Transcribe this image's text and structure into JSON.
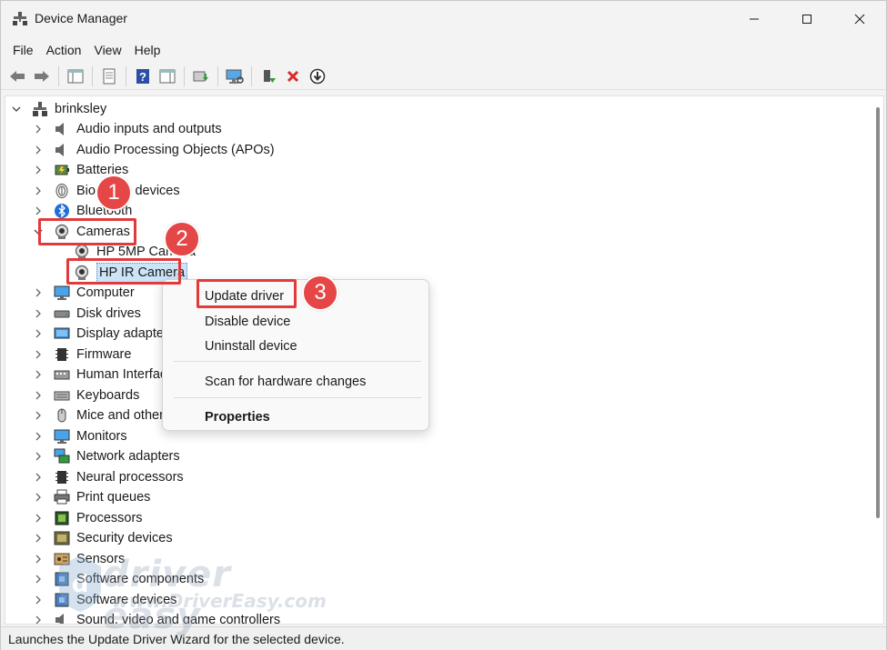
{
  "window": {
    "title": "Device Manager"
  },
  "menu": [
    "File",
    "Action",
    "View",
    "Help"
  ],
  "toolbar": [
    "back-icon",
    "forward-icon",
    "show-hide-console-tree-icon",
    "properties-icon",
    "help-icon",
    "action-pane-icon",
    "update-driver-icon",
    "scan-hardware-icon",
    "enable-device-icon",
    "uninstall-icon",
    "download-icon"
  ],
  "tree": {
    "root": "brinksley",
    "categories": [
      {
        "label": "Audio inputs and outputs",
        "icon": "speaker-icon"
      },
      {
        "label": "Audio Processing Objects (APOs)",
        "icon": "speaker-icon"
      },
      {
        "label": "Batteries",
        "icon": "battery-icon"
      },
      {
        "label": "Biometric devices",
        "icon": "fingerprint-icon"
      },
      {
        "label": "Bluetooth",
        "icon": "bluetooth-icon"
      },
      {
        "label": "Cameras",
        "icon": "camera-icon",
        "expanded": true
      },
      {
        "label": "Computer",
        "icon": "monitor-icon"
      },
      {
        "label": "Disk drives",
        "icon": "disk-icon"
      },
      {
        "label": "Display adapters",
        "icon": "display-adapter-icon"
      },
      {
        "label": "Firmware",
        "icon": "chip-icon"
      },
      {
        "label": "Human Interface Devices",
        "icon": "hid-icon"
      },
      {
        "label": "Keyboards",
        "icon": "keyboard-icon"
      },
      {
        "label": "Mice and other pointing devices",
        "icon": "mouse-icon"
      },
      {
        "label": "Monitors",
        "icon": "monitor-icon"
      },
      {
        "label": "Network adapters",
        "icon": "network-icon"
      },
      {
        "label": "Neural processors",
        "icon": "chip-icon"
      },
      {
        "label": "Print queues",
        "icon": "printer-icon"
      },
      {
        "label": "Processors",
        "icon": "processor-icon"
      },
      {
        "label": "Security devices",
        "icon": "security-icon"
      },
      {
        "label": "Sensors",
        "icon": "sensor-icon"
      },
      {
        "label": "Software components",
        "icon": "puzzle-icon"
      },
      {
        "label": "Software devices",
        "icon": "puzzle-icon"
      },
      {
        "label": "Sound, video and game controllers",
        "icon": "speaker-icon"
      }
    ],
    "cameras_children": [
      "HP 5MP Camera",
      "HP IR Camera"
    ]
  },
  "context_menu": {
    "update_driver": "Update driver",
    "disable_device": "Disable device",
    "uninstall_device": "Uninstall device",
    "scan": "Scan for hardware changes",
    "properties": "Properties"
  },
  "annotations": {
    "step1": "1",
    "step2": "2",
    "step3": "3"
  },
  "status": "Launches the Update Driver Wizard for the selected device.",
  "watermark": {
    "brand": "driver easy",
    "url": "www.DriverEasy.com"
  },
  "colors": {
    "highlight": "#e23a3a",
    "badge": "#e54646",
    "selection": "#cce4f7"
  }
}
